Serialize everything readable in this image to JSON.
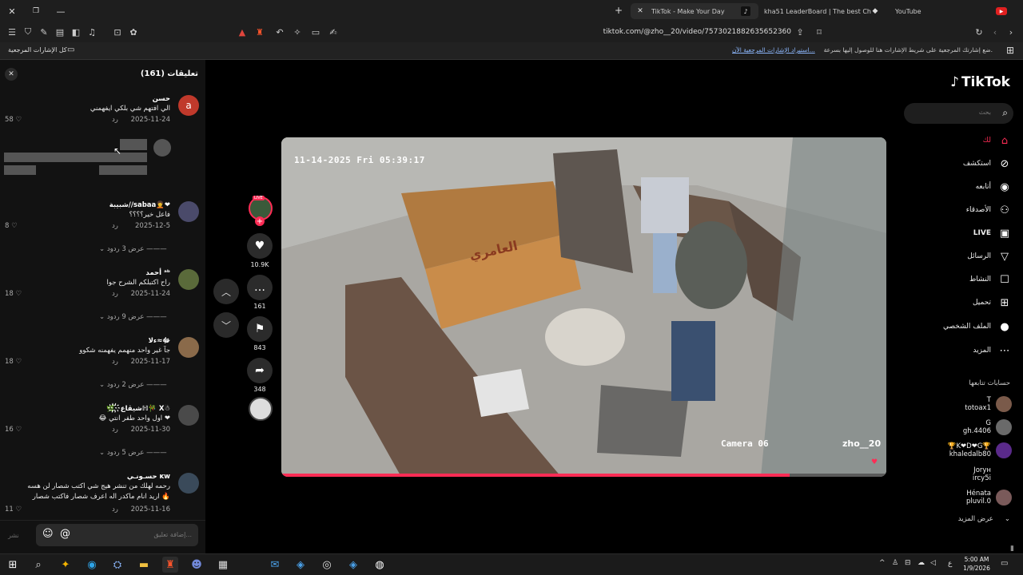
{
  "browser": {
    "tabs": [
      {
        "title": "TikTok - Make Your Day",
        "active": true
      },
      {
        "title": "kha51 LeaderBoard | The best ChatBo",
        "active": false
      },
      {
        "title": "YouTube",
        "active": false
      }
    ],
    "url": "tiktok.com/@zho__20/video/7573021882635652360",
    "bookmark_prompt": "ضع إشارتك المرجعية على شريط الإشارات هنا للوصول إليها بسرعة.",
    "bookmark_import": "استيراد الإشارات المرجعية الآن...",
    "bookmark_folder": "كل الإشارات المرجعية"
  },
  "comments_panel": {
    "title": "تعليقات (161)",
    "items": [
      {
        "user": "حسن",
        "text": "الي افتهم شي بلكي ايفهمني",
        "date": "2025-11-24",
        "reply": "رد",
        "likes": "58",
        "avatar_letter": "a",
        "avatar_color": "#c0392b"
      },
      {
        "user": "شبيبة//sabaa🧑‍🦱❤",
        "text": "فاعل خير؟؟؟؟",
        "date": "2025-12-5",
        "reply": "رد",
        "likes": "8",
        "more": "عرض 3 ردود",
        "avatar_color": "#4a4a6a"
      },
      {
        "user": "أحمد ᵃᵇ",
        "text": "راح اكتبلكم الشرح جوا",
        "date": "2025-11-24",
        "reply": "رد",
        "likes": "18",
        "more": "عرض 9 ردود",
        "avatar_color": "#5a6a3a"
      },
      {
        "user": "ﷻ≈ءلا",
        "text": "جآ غير واحد منهمم يفهمنه شكوو",
        "date": "2025-11-17",
        "reply": "رد",
        "likes": "18",
        "more": "عرض 2 ردود",
        "avatar_color": "#8a6a4a"
      },
      {
        "user": "🌿҉شيڨاع҉ℍ🎋 X☃",
        "text": "❤ اول واحد طفر انتي 😂",
        "date": "2025-11-30",
        "reply": "رد",
        "likes": "16",
        "more": "عرض 5 ردود",
        "avatar_color": "#4a4a4a"
      },
      {
        "user": "حسـونـي ᴋᴡ",
        "text": "رحمه لهلك من تنشر هيج شي اكتب شصار لن هسه",
        "text2": "🔥 اريد انام ماكدر اله اعرف شصار فاكتب شصار",
        "date": "2025-11-16",
        "reply": "رد",
        "likes": "11",
        "avatar_color": "#3a4a5a"
      }
    ],
    "input_placeholder": "إضافة تعليق...",
    "post_label": "نشر"
  },
  "video": {
    "timestamp": "11-14-2025 Fri 05:39:17",
    "camera_label": "Camera 06",
    "watermark": "zho__20",
    "desk_text": "العامري",
    "progress": 0.84
  },
  "actions": {
    "live_badge": "LIVE",
    "likes": "10.9K",
    "comments": "161",
    "saves": "843",
    "shares": "348"
  },
  "sidebar": {
    "logo": "TikTok",
    "search_placeholder": "بحث",
    "nav": [
      {
        "label": "لك",
        "icon": "home-icon",
        "active": true
      },
      {
        "label": "استكشف",
        "icon": "compass-icon"
      },
      {
        "label": "أتابعه",
        "icon": "following-icon"
      },
      {
        "label": "الأصدقاء",
        "icon": "friends-icon"
      },
      {
        "label": "LIVE",
        "icon": "live-icon"
      },
      {
        "label": "الرسائل",
        "icon": "messages-icon"
      },
      {
        "label": "النشاط",
        "icon": "activity-icon"
      },
      {
        "label": "تحميل",
        "icon": "upload-icon"
      },
      {
        "label": "الملف الشخصي",
        "icon": "profile-icon"
      },
      {
        "label": "المزيد",
        "icon": "more-icon"
      }
    ],
    "following_title": "حسابات تتابعها",
    "following": [
      {
        "line1": "T",
        "line2": "totoax1",
        "color": "#7a5a4a"
      },
      {
        "line1": "G",
        "line2": "gh.4406",
        "color": "#6a6a6a"
      },
      {
        "line1": "🏆K❤D❤G🏆",
        "line2": "khaledalb80",
        "color": "#5a2a8a"
      },
      {
        "line1": "Joryʜ",
        "line2": "ircy5i",
        "color": "#3a3a3a"
      },
      {
        "line1": "Hénata",
        "line2": "pluvil.0",
        "color": "#7a5a5a"
      }
    ],
    "see_more": "عرض المزيد"
  },
  "taskbar": {
    "time": "5:00 AM",
    "date": "1/9/2026",
    "lang": "ع"
  }
}
